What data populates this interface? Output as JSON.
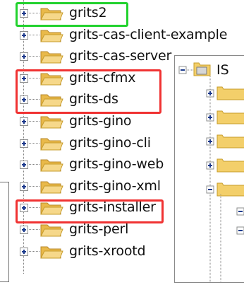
{
  "tree": {
    "items": [
      {
        "label": "grits2",
        "highlight": "green"
      },
      {
        "label": "grits-cas-client-example",
        "highlight": ""
      },
      {
        "label": "grits-cas-server",
        "highlight": ""
      },
      {
        "label": "grits-cfmx",
        "highlight": "red"
      },
      {
        "label": "grits-ds",
        "highlight": "red"
      },
      {
        "label": "grits-gino",
        "highlight": ""
      },
      {
        "label": "grits-gino-cli",
        "highlight": ""
      },
      {
        "label": "grits-gino-web",
        "highlight": ""
      },
      {
        "label": "grits-gino-xml",
        "highlight": ""
      },
      {
        "label": "grits-installer",
        "highlight": "red"
      },
      {
        "label": "grits-perl",
        "highlight": ""
      },
      {
        "label": "grits-xrootd",
        "highlight": ""
      }
    ]
  },
  "back_panel": {
    "root_label": "IS"
  },
  "colors": {
    "highlight_green": "#22d22e",
    "highlight_red": "#f03232",
    "folder_fill": "#f3cf6a",
    "folder_edge": "#c79c2b",
    "expander_sign": "#1b3a8c"
  }
}
